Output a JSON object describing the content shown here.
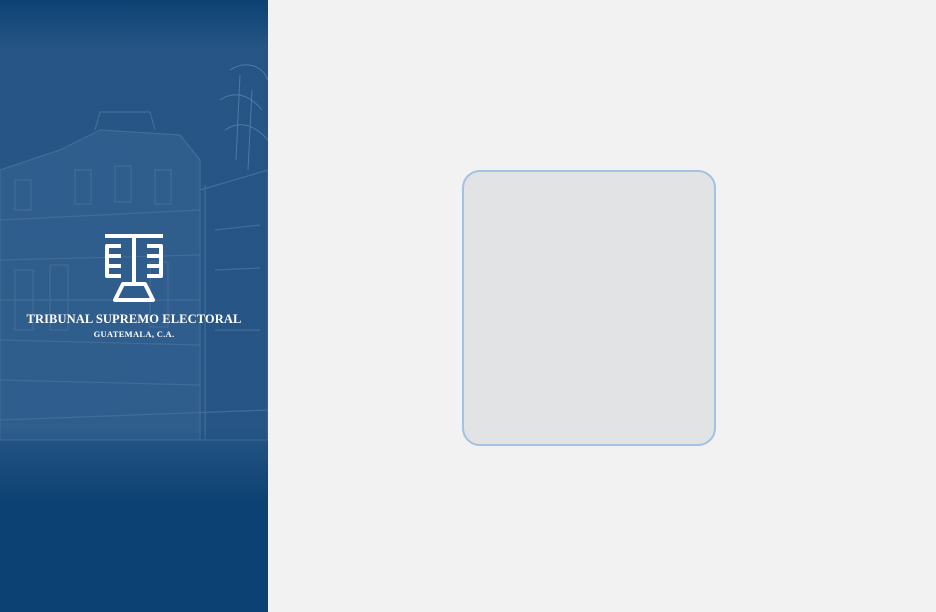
{
  "sidebar": {
    "organization_name": "TRIBUNAL SUPREMO ELECTORAL",
    "organization_location": "GUATEMALA, C.A.",
    "logo_icon": "tse-emblem-icon",
    "background_image": "historic-building-illustration",
    "background_color": "#0c4273"
  },
  "main": {
    "background_color": "#f2f2f2",
    "card": {
      "fill_color": "#e2e3e5",
      "border_color": "#a3c1e3"
    }
  }
}
